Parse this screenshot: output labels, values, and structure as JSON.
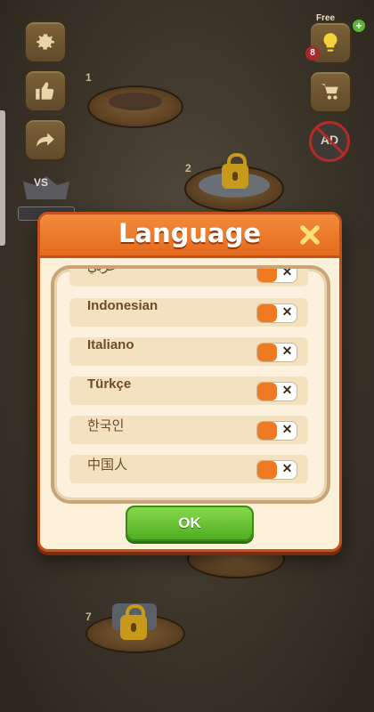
{
  "hud": {
    "hint_free_label": "Free",
    "hint_count": "8",
    "no_ads_label": "AD"
  },
  "levels": {
    "level_1": "1",
    "level_2": "2",
    "level_7": "7",
    "vs_label": "VS"
  },
  "modal": {
    "title": "Language",
    "ok_label": "OK",
    "languages": [
      {
        "label": "عربي",
        "selected": false
      },
      {
        "label": "Indonesian",
        "selected": false
      },
      {
        "label": "Italiano",
        "selected": false
      },
      {
        "label": "Türkçe",
        "selected": false
      },
      {
        "label": "한국인",
        "selected": false
      },
      {
        "label": "中国人",
        "selected": false
      }
    ]
  },
  "colors": {
    "header_orange": "#e66a1e",
    "toggle_orange": "#ef7a21",
    "ok_green": "#4fae22",
    "row_bg": "#f4e1c0",
    "label_brown": "#6d4b2b"
  },
  "icons": {
    "settings": "gear-icon",
    "like": "thumbs-up-icon",
    "share": "share-arrow-icon",
    "hint": "lightbulb-icon",
    "shop": "shopping-cart-icon",
    "close": "close-icon",
    "toggle_off": "x-mark-icon",
    "lock": "padlock-icon"
  }
}
